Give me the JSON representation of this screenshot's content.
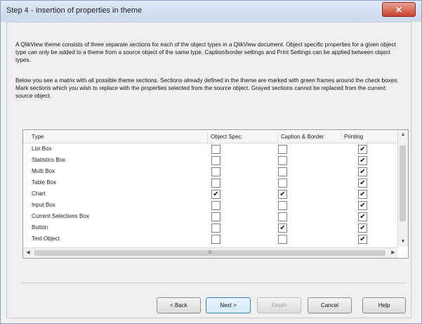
{
  "window": {
    "title": "Step 4 - Insertion of properties in theme",
    "close_label": "✕"
  },
  "intro": {
    "paragraph1": "A QlikView theme consists of three separate sections for each of the object types in a QlikView document. Object specific properties for a given object type can only be added to a theme from a source object of the same type. Caption/border settings and Print Settings can be applied between object types.",
    "paragraph2": "Below you see a matrix with all possible theme sections. Sections already defined in the theme are marked with green frames around the check boxes. Mark sections which you wish to replace with the properties selected from the source object. Grayed sections cannot be replaced from the current source object."
  },
  "grid": {
    "headers": {
      "type": "Type",
      "object_spec": "Object Spec.",
      "caption_border": "Caption & Border",
      "printing": "Printing"
    },
    "rows": [
      {
        "name": "List Box",
        "obj": "",
        "cap": "",
        "pri": "✔"
      },
      {
        "name": "Statistics Box",
        "obj": "",
        "cap": "",
        "pri": "✔"
      },
      {
        "name": "Multi Box",
        "obj": "",
        "cap": "",
        "pri": "✔"
      },
      {
        "name": "Table Box",
        "obj": "",
        "cap": "",
        "pri": "✔"
      },
      {
        "name": "Chart",
        "obj": "✔",
        "cap": "✔",
        "pri": "✔"
      },
      {
        "name": "Input Box",
        "obj": "",
        "cap": "",
        "pri": "✔"
      },
      {
        "name": "Current Selections Box",
        "obj": "",
        "cap": "",
        "pri": "✔"
      },
      {
        "name": "Button",
        "obj": "",
        "cap": "✔",
        "pri": "✔"
      },
      {
        "name": "Text Object",
        "obj": "",
        "cap": "",
        "pri": "✔"
      }
    ],
    "hscroll_label": "III"
  },
  "buttons": {
    "back": "< Back",
    "next": "Next >",
    "finish": "Finish",
    "cancel": "Cancel",
    "help": "Help"
  }
}
